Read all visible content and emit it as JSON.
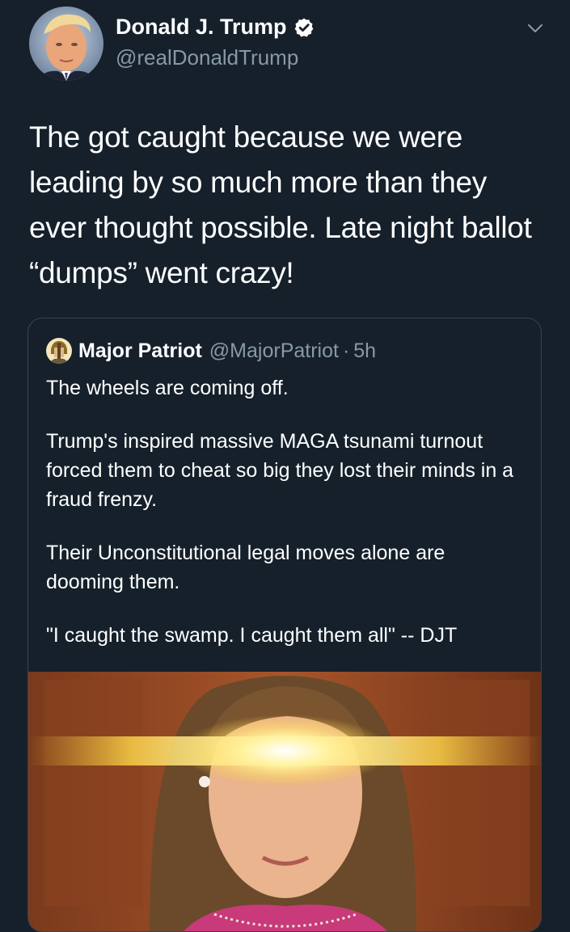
{
  "tweet": {
    "author_name": "Donald J. Trump",
    "author_handle": "@realDonaldTrump",
    "verified": true,
    "avatar_icon": "profile-photo",
    "text_lines": [
      "The got caught because we were",
      "leading by so much more than they",
      "ever thought possible. Late night ballot",
      "“dumps” went crazy!"
    ]
  },
  "quoted_tweet": {
    "author_name": "Major Patriot",
    "author_handle": "@MajorPatriot",
    "separator": "·",
    "time": "5h",
    "avatar_icon": "profile-photo",
    "paragraphs": [
      "The wheels are coming off.",
      "Trump's inspired massive MAGA tsunami turnout forced them to cheat so big they lost their minds in a fraud frenzy.",
      "Their Unconstitutional legal moves alone are dooming them.",
      "\"I caught the swamp. I caught them all\" -- DJT"
    ],
    "media": {
      "kind": "photo",
      "icon": "glowing-eyes-meme-photo"
    }
  },
  "colors": {
    "background": "#15202b",
    "text_primary": "#ffffff",
    "text_secondary": "#8899a6",
    "border": "#38444d",
    "verified_badge": "#ffffff"
  }
}
